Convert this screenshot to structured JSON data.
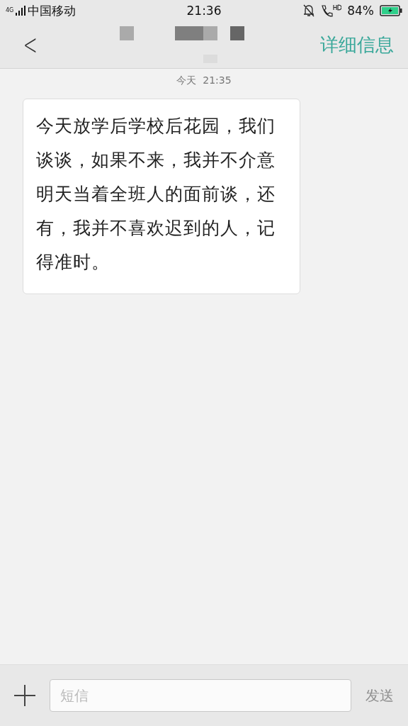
{
  "status_bar": {
    "network": "4G",
    "carrier": "中国移动",
    "time": "21:36",
    "battery": "84%"
  },
  "header": {
    "back": "<",
    "action": "详细信息"
  },
  "messages": [
    {
      "timestamp": "今天  21:35",
      "text": "今天放学后学校后花园，我们谈谈，如果不来，我并不介意明天当着全班人的面前谈，还有，我并不喜欢迟到的人，记得准时。"
    }
  ],
  "composer": {
    "placeholder": "短信",
    "send": "发送",
    "send_disabled": true
  }
}
